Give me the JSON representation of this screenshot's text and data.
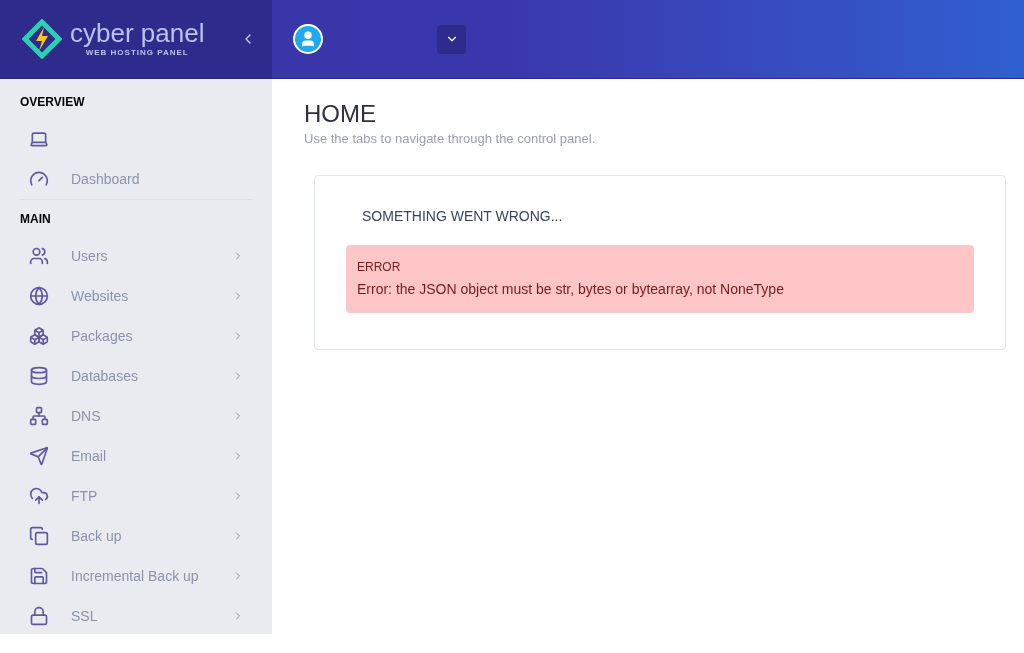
{
  "logo": {
    "name": "cyber panel",
    "tagline": "WEB HOSTING PANEL"
  },
  "sidebar": {
    "sections": [
      {
        "heading": "OVERVIEW",
        "items": [
          {
            "kind": "icon_only"
          },
          {
            "kind": "link",
            "label": "Dashboard"
          }
        ]
      },
      {
        "heading": "MAIN",
        "items": [
          {
            "kind": "submenu",
            "label": "Users"
          },
          {
            "kind": "submenu",
            "label": "Websites"
          },
          {
            "kind": "submenu",
            "label": "Packages"
          },
          {
            "kind": "submenu",
            "label": "Databases"
          },
          {
            "kind": "submenu",
            "label": "DNS"
          },
          {
            "kind": "submenu",
            "label": "Email"
          },
          {
            "kind": "submenu",
            "label": "FTP"
          },
          {
            "kind": "submenu",
            "label": "Back up"
          },
          {
            "kind": "submenu",
            "label": "Incremental Back up"
          },
          {
            "kind": "submenu",
            "label": "SSL"
          }
        ]
      }
    ]
  },
  "page": {
    "title": "HOME",
    "subtitle": "Use the tabs to navigate through the control panel."
  },
  "card": {
    "heading": "SOMETHING WENT WRONG...",
    "alert": {
      "title": "ERROR",
      "message": "Error: the JSON object must be str, bytes or bytearray, not NoneType"
    }
  }
}
